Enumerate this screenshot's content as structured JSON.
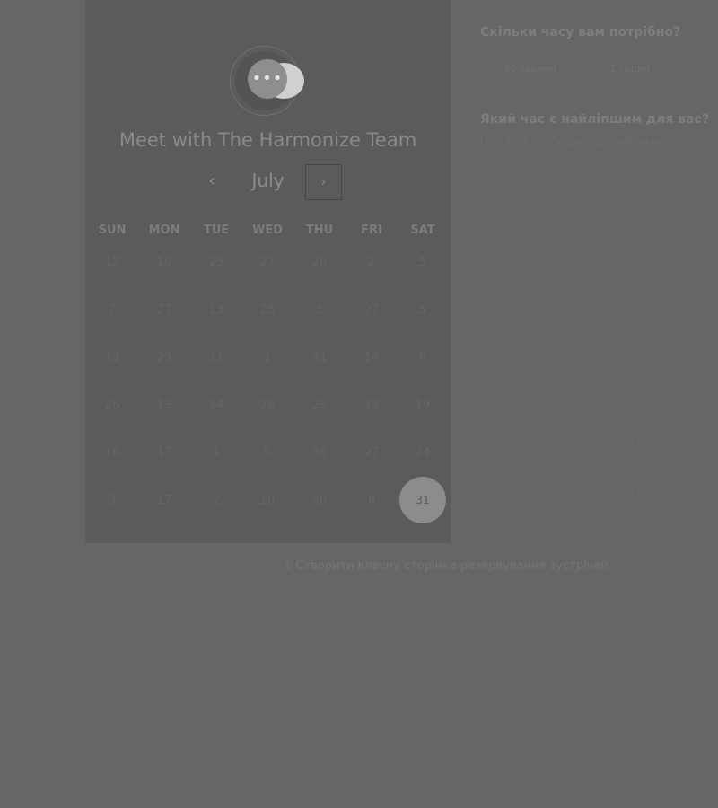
{
  "calendar": {
    "title": "Meet with The Harmonize Team",
    "month": "July",
    "prev_icon": "‹",
    "next_icon": "›",
    "weekdays": [
      "SUN",
      "MON",
      "TUE",
      "WED",
      "THU",
      "FRI",
      "SAT"
    ],
    "weeks": [
      [
        "12",
        "10",
        "25",
        "27",
        "20",
        "2",
        "5"
      ],
      [
        "7",
        "27",
        "13",
        "25",
        "3",
        "27",
        "5"
      ],
      [
        "13",
        "29",
        "11",
        "1",
        "31",
        "14",
        "6"
      ],
      [
        "26",
        "13",
        "24",
        "26",
        "29",
        "19",
        "19"
      ],
      [
        "16",
        "17",
        "1",
        "6",
        "30",
        "27",
        "24"
      ],
      [
        "3",
        "17",
        "2",
        "10",
        "20",
        "8",
        "31"
      ]
    ],
    "selected_day": "31",
    "avatar_icon": "chat-bubbles-icon",
    "avatar_glyph": "•••"
  },
  "booking": {
    "duration_question": "Скільки часу вам потрібно?",
    "durations": [
      "30 хвилин",
      "1 годин"
    ],
    "time_question": "Який час є найліпшим для вас?",
    "timezone": "UTC +03:00 Східноєвропейський час",
    "slots": [
      "7:00 pm",
      "8:00 pm",
      "9:00 pm",
      "9:30 pm",
      "9:30 pm",
      "10:00 pm",
      "10:30 pm"
    ]
  },
  "footer": {
    "icon": "hubspot-sprocket-icon",
    "glyph": "⅌",
    "link_text": "Створити власну сторінка резервування зустрічей"
  }
}
